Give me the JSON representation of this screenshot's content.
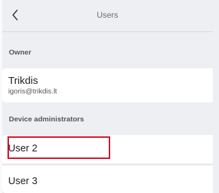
{
  "header": {
    "title": "Users",
    "back_icon": "chevron-left-icon"
  },
  "owner_section": {
    "label": "Owner",
    "owner": {
      "name": "Trikdis",
      "email": "igoris@trikdis.lt"
    }
  },
  "admins_section": {
    "label": "Device administrators",
    "users": [
      {
        "label": "User 2",
        "highlighted": true
      },
      {
        "label": "User 3",
        "highlighted": false
      }
    ]
  },
  "colors": {
    "background": "#eeeff3",
    "card": "#ffffff",
    "highlight": "#d9001b"
  }
}
